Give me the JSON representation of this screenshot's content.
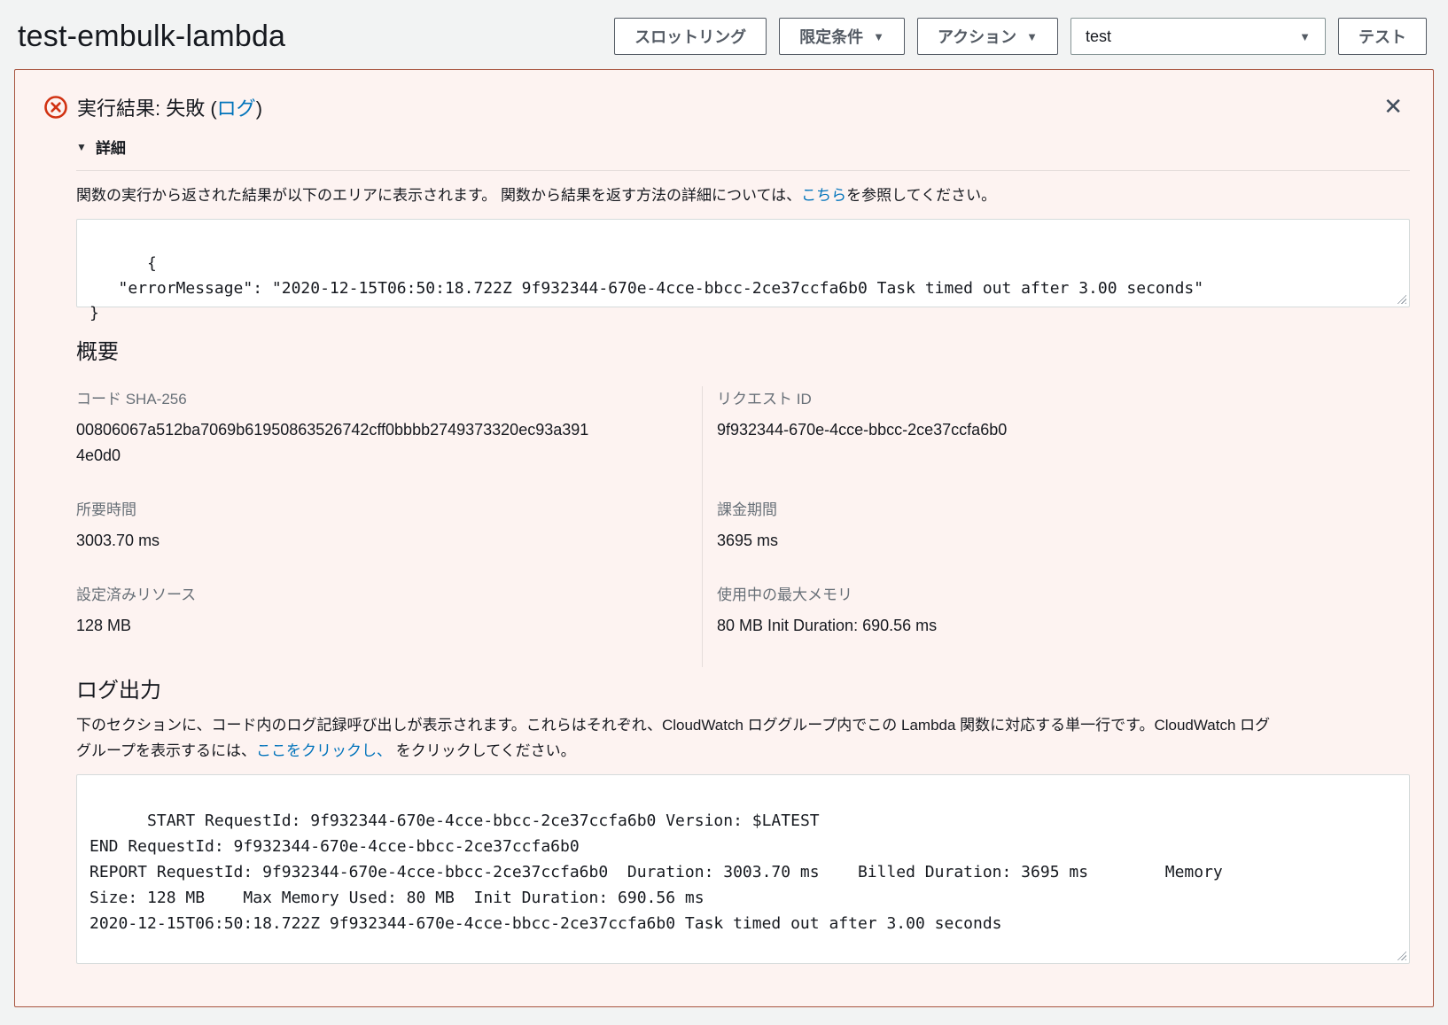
{
  "header": {
    "title": "test-embulk-lambda",
    "throttling_button": "スロットリング",
    "qualifier_button": "限定条件",
    "actions_button": "アクション",
    "test_event_selected": "test",
    "test_button": "テスト"
  },
  "icons": {
    "caret_down": "▼",
    "details_caret": "▼",
    "close": "✕"
  },
  "banner": {
    "title_before_link": "実行結果: 失敗 (",
    "log_link": "ログ",
    "title_after_link": ")",
    "details_toggle": "詳細",
    "intro": {
      "before_link": "関数の実行から返された結果が以下のエリアに表示されます。 関数から結果を返す方法の詳細については、",
      "link": "こちら",
      "after_link": "を参照してください。"
    },
    "error_output": "{\n   \"errorMessage\": \"2020-12-15T06:50:18.722Z 9f932344-670e-4cce-bbcc-2ce37ccfa6b0 Task timed out after 3.00 seconds\"\n}",
    "summary": {
      "heading": "概要",
      "cells": [
        {
          "label": "コード SHA-256",
          "value": "00806067a512ba7069b61950863526742cff0bbbb2749373320ec93a3914e0d0"
        },
        {
          "label": "リクエスト ID",
          "value": "9f932344-670e-4cce-bbcc-2ce37ccfa6b0"
        },
        {
          "label": "所要時間",
          "value": "3003.70 ms"
        },
        {
          "label": "課金期間",
          "value": "3695 ms"
        },
        {
          "label": "設定済みリソース",
          "value": "128 MB"
        },
        {
          "label": "使用中の最大メモリ",
          "value": "80 MB Init Duration: 690.56 ms"
        }
      ]
    },
    "log_section": {
      "heading": "ログ出力",
      "desc_before_link": "下のセクションに、コード内のログ記録呼び出しが表示されます。これらはそれぞれ、CloudWatch ロググループ内でこの Lambda 関数に対応する単一行です。CloudWatch ロググループを表示するには、",
      "link": "ここをクリックし、",
      "desc_after_link": " をクリックしてください。",
      "log_text": "START RequestId: 9f932344-670e-4cce-bbcc-2ce37ccfa6b0 Version: $LATEST\nEND RequestId: 9f932344-670e-4cce-bbcc-2ce37ccfa6b0\nREPORT RequestId: 9f932344-670e-4cce-bbcc-2ce37ccfa6b0  Duration: 3003.70 ms    Billed Duration: 3695 ms        Memory\nSize: 128 MB    Max Memory Used: 80 MB  Init Duration: 690.56 ms\n2020-12-15T06:50:18.722Z 9f932344-670e-4cce-bbcc-2ce37ccfa6b0 Task timed out after 3.00 seconds"
    }
  },
  "colors": {
    "page_background": "#f2f3f3",
    "banner_background": "#fdf3f1",
    "banner_border": "#a85540",
    "error_red": "#d13212",
    "link_blue": "#0073bb",
    "label_gray": "#687078"
  }
}
